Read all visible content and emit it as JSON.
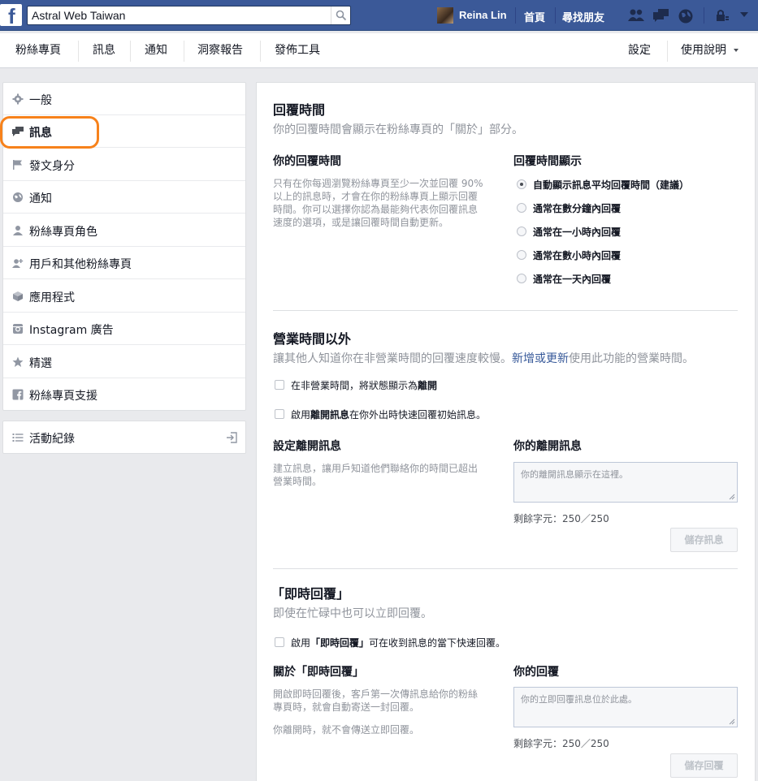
{
  "topbar": {
    "search_value": "Astral Web Taiwan",
    "user_name": "Reina Lin",
    "home_label": "首頁",
    "find_friends_label": "尋找朋友"
  },
  "subnav": {
    "items": [
      "粉絲專頁",
      "訊息",
      "通知",
      "洞察報告",
      "發佈工具"
    ],
    "settings_label": "設定",
    "help_label": "使用說明"
  },
  "sidebar": {
    "items": [
      {
        "label": "一般",
        "icon": "gear-icon"
      },
      {
        "label": "訊息",
        "icon": "messages-icon"
      },
      {
        "label": "發文身分",
        "icon": "flag-icon"
      },
      {
        "label": "通知",
        "icon": "globe-icon"
      },
      {
        "label": "粉絲專頁角色",
        "icon": "person-icon"
      },
      {
        "label": "用戶和其他粉絲專頁",
        "icon": "person-add-icon"
      },
      {
        "label": "應用程式",
        "icon": "cube-icon"
      },
      {
        "label": "Instagram 廣告",
        "icon": "instagram-icon"
      },
      {
        "label": "精選",
        "icon": "star-icon"
      },
      {
        "label": "粉絲專頁支援",
        "icon": "facebook-icon"
      }
    ],
    "activity_log_label": "活動紀錄"
  },
  "response_time": {
    "title": "回覆時間",
    "subtitle": "你的回覆時間會顯示在粉絲專頁的「關於」部分。",
    "left_title": "你的回覆時間",
    "left_desc_1": "只有在你每週瀏覽粉絲專頁至少一次並回覆 90%",
    "left_desc_2": "以上的訊息時，才會在你的粉絲專頁上顯示回覆",
    "left_desc_3": "時間。你可以選擇你認為最能夠代表你回覆訊息",
    "left_desc_4": "速度的選項，或是讓回覆時間自動更新。",
    "right_title": "回覆時間顯示",
    "options": [
      "自動顯示訊息平均回覆時間（建議）",
      "通常在數分鐘內回覆",
      "通常在一小時內回覆",
      "通常在數小時內回覆",
      "通常在一天內回覆"
    ]
  },
  "away": {
    "title": "營業時間以外",
    "subtitle_1": "讓其他人知道你在非營業時間的回覆速度較慢。",
    "subtitle_link": "新增或更新",
    "subtitle_2": "使用此功能的營業時間。",
    "cb1_text": "在非營業時間，將狀態顯示為",
    "cb1_bold": "離開",
    "cb2_text_1": "啟用",
    "cb2_bold": "離開訊息",
    "cb2_text_2": "在你外出時快速回覆初始訊息。",
    "left_title": "設定離開訊息",
    "left_desc_1": "建立訊息，讓用戶知道他們聯絡你的時間已超出",
    "left_desc_2": "營業時間。",
    "right_title": "你的離開訊息",
    "placeholder": "你的離開訊息顯示在這裡。",
    "remaining": "剩餘字元：250／250",
    "save_label": "儲存訊息"
  },
  "instant": {
    "title": "「即時回覆」",
    "subtitle": "即使在忙碌中也可以立即回覆。",
    "cb_text_1": "啟用",
    "cb_bold": "「即時回覆」",
    "cb_text_2": "可在收到訊息的當下快速回覆。",
    "left_title": "關於「即時回覆」",
    "left_desc_1": "開啟即時回覆後，客戶第一次傳訊息給你的粉絲",
    "left_desc_2": "專頁時，就會自動寄送一封回覆。",
    "left_desc_3": "你離開時，就不會傳送立即回覆。",
    "right_title": "你的回覆",
    "placeholder": "你的立即回覆訊息位於此處。",
    "remaining": "剩餘字元：250／250",
    "save_label": "儲存回覆"
  },
  "colors": {
    "brand": "#3b5998",
    "highlight": "#f7821b"
  }
}
